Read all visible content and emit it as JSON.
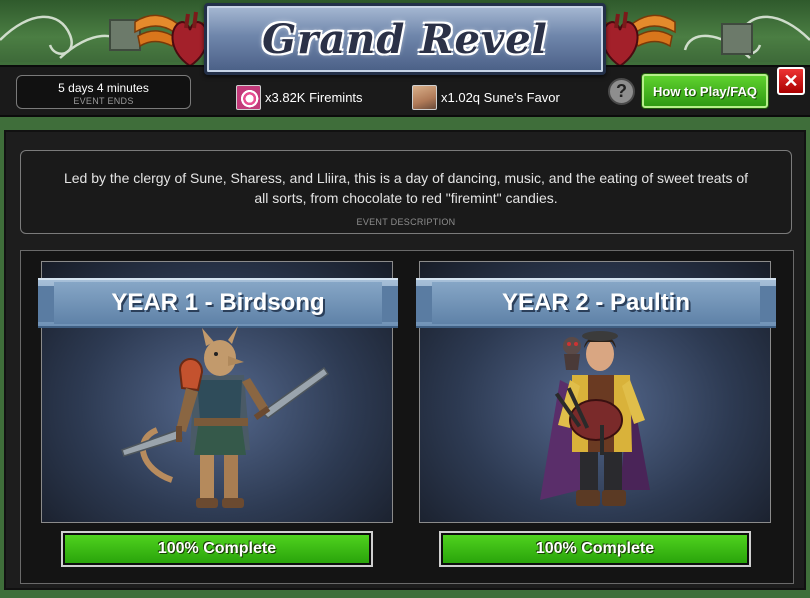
{
  "header": {
    "title": "Grand Revel"
  },
  "timer": {
    "value": "5 days 4 minutes",
    "label": "EVENT ENDS"
  },
  "currencies": [
    {
      "icon": "firemint-icon",
      "text": "x3.82K Firemints"
    },
    {
      "icon": "favor-portrait-icon",
      "text": "x1.02q Sune's Favor"
    }
  ],
  "buttons": {
    "help": "?",
    "how_to_play": "How to Play/FAQ",
    "close": "✕"
  },
  "description": {
    "text": "Led by the clergy of Sune, Sharess, and Lliira, this is a day of dancing, music, and the eating of sweet treats of all sorts, from chocolate to red \"firemint\" candies.",
    "label": "EVENT DESCRIPTION"
  },
  "years": [
    {
      "title": "YEAR 1 - Birdsong",
      "progress_label": "100% Complete",
      "progress": 1.0
    },
    {
      "title": "YEAR 2 - Paultin",
      "progress_label": "100% Complete",
      "progress": 1.0
    }
  ],
  "colors": {
    "accent_green": "#3fbf17",
    "close_red": "#d00000",
    "banner_blue": "#6f86ab"
  }
}
